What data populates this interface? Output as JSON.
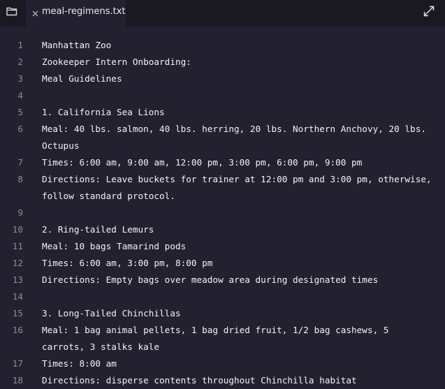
{
  "tab": {
    "title": "meal-regimens.txt"
  },
  "icons": {
    "folder": "folder-icon",
    "close": "close-icon",
    "expand": "expand-icon"
  },
  "lines": [
    {
      "num": "1",
      "text": [
        "Manhattan Zoo"
      ]
    },
    {
      "num": "2",
      "text": [
        "Zookeeper Intern Onboarding:"
      ]
    },
    {
      "num": "3",
      "text": [
        "Meal Guidelines"
      ]
    },
    {
      "num": "4",
      "text": [
        ""
      ]
    },
    {
      "num": "5",
      "text": [
        "1. California Sea Lions"
      ]
    },
    {
      "num": "6",
      "text": [
        "Meal: 40 lbs. salmon, 40 lbs. herring, 20 lbs. Northern Anchovy, 20 lbs.",
        "Octupus"
      ]
    },
    {
      "num": "7",
      "text": [
        "Times: 6:00 am, 9:00 am, 12:00 pm, 3:00 pm, 6:00 pm, 9:00 pm"
      ]
    },
    {
      "num": "8",
      "text": [
        "Directions: Leave buckets for trainer at 12:00 pm and 3:00 pm, otherwise,",
        "follow standard protocol."
      ]
    },
    {
      "num": "9",
      "text": [
        ""
      ]
    },
    {
      "num": "10",
      "text": [
        "2. Ring-tailed Lemurs"
      ]
    },
    {
      "num": "11",
      "text": [
        "Meal: 10 bags Tamarind pods"
      ]
    },
    {
      "num": "12",
      "text": [
        "Times: 6:00 am, 3:00 pm, 8:00 pm"
      ]
    },
    {
      "num": "13",
      "text": [
        "Directions: Empty bags over meadow area during designated times"
      ]
    },
    {
      "num": "14",
      "text": [
        ""
      ]
    },
    {
      "num": "15",
      "text": [
        "3. Long-Tailed Chinchillas"
      ]
    },
    {
      "num": "16",
      "text": [
        "Meal: 1 bag animal pellets, 1 bag dried fruit, 1/2 bag cashews, 5",
        "carrots, 3 stalks kale"
      ]
    },
    {
      "num": "17",
      "text": [
        "Times: 8:00 am"
      ]
    },
    {
      "num": "18",
      "text": [
        "Directions: disperse contents throughout Chinchilla habitat"
      ]
    }
  ]
}
